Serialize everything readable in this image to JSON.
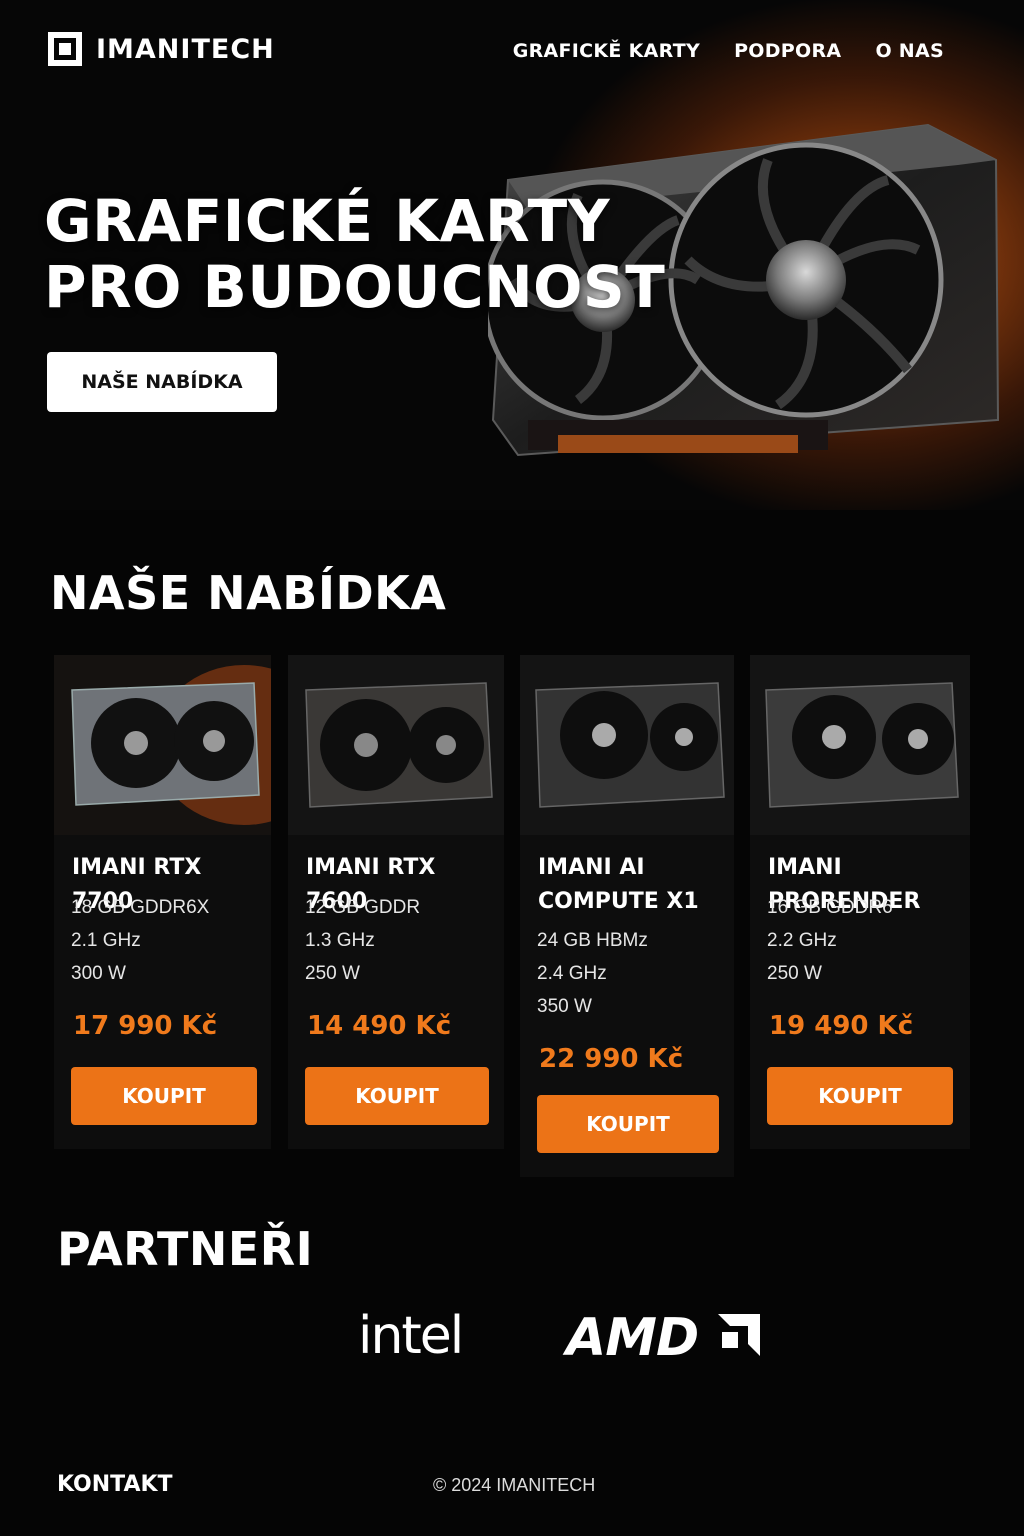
{
  "brand": {
    "name": "IMANITECH"
  },
  "nav": {
    "items": [
      "GRAFICKĚ KARTY",
      "PODPORA",
      "O NAS"
    ]
  },
  "hero": {
    "title_line1": "GRAFICKÉ KARTY",
    "title_line2": "PRO BUDOUCNOST",
    "cta_label": "NAŠE NABÍDKA"
  },
  "offer": {
    "title": "NAŠE NABÍDKA",
    "products": [
      {
        "name": "IMANI RTX 7700",
        "specs": [
          "18 GB GDDR6X",
          "2.1 GHz",
          "300 W"
        ],
        "price": "17 990 Kč",
        "buy_label": "KOUPIT"
      },
      {
        "name": "IMANI RTX 7600",
        "specs": [
          "12 GB GDDR",
          "1.3 GHz",
          "250 W"
        ],
        "price": "14 490 Kč",
        "buy_label": "KOUPIT"
      },
      {
        "name": "IMANI AI COMPUTE X1",
        "specs": [
          "24 GB HBMz",
          "2.4 GHz",
          "350 W"
        ],
        "price": "22 990 Kč",
        "buy_label": "KOUPIT"
      },
      {
        "name": "IMANI PRORENDER",
        "specs": [
          "16 GB GDDR6",
          "2.2 GHz",
          "250 W"
        ],
        "price": "19 490 Kč",
        "buy_label": "KOUPIT"
      }
    ]
  },
  "partners": {
    "title": "PARTNEŘI",
    "logos": [
      "intel",
      "AMD"
    ]
  },
  "footer": {
    "contact": "KONTAKT",
    "copyright": "© 2024 IMANITECH"
  },
  "colors": {
    "accent": "#ec7317",
    "price": "#f07a1c",
    "background": "#050505"
  }
}
